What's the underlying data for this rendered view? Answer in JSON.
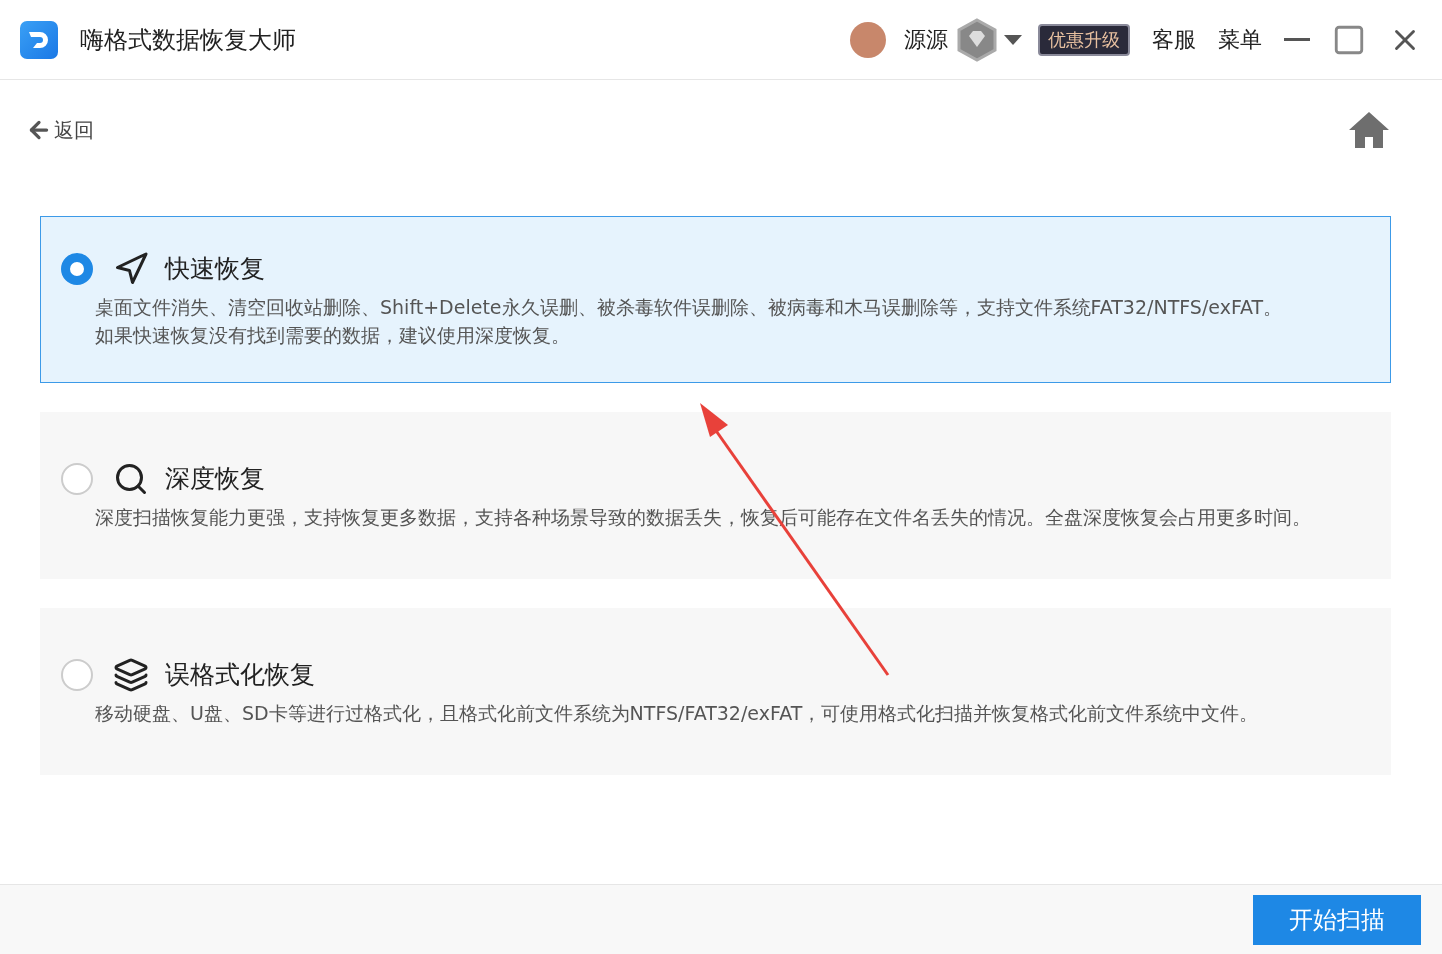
{
  "window": {
    "title": "嗨格式数据恢复大师"
  },
  "user": {
    "name": "源源"
  },
  "header_links": [
    {
      "label": "优惠升级",
      "kind": "promo"
    },
    {
      "label": "客服",
      "kind": "plain"
    },
    {
      "label": "菜单",
      "kind": "plain"
    }
  ],
  "back": {
    "label": "返回"
  },
  "options": [
    {
      "title": "快速恢复",
      "selected": true,
      "description_lines": [
        "桌面文件消失、清空回收站删除、Shift+Delete永久误删、被杀毒软件误删除、被病毒和木马误删除等，支持文件系统FAT32/NTFS/exFAT。",
        "如果快速恢复没有找到需要的数据，建议使用深度恢复。"
      ]
    },
    {
      "title": "深度恢复",
      "selected": false,
      "description_lines": [
        "深度扫描恢复能力更强，支持恢复更多数据，支持各种场景导致的数据丢失，恢复后可能存在文件名丢失的情况。全盘深度恢复会占用更多时间。"
      ]
    },
    {
      "title": "误格式化恢复",
      "selected": false,
      "description_lines": [
        "移动硬盘、U盘、SD卡等进行过格式化，且格式化前文件系统为NTFS/FAT32/exFAT，可使用格式化扫描并恢复格式化前文件系统中文件。"
      ]
    }
  ],
  "footer": {
    "button": "开始扫描"
  }
}
